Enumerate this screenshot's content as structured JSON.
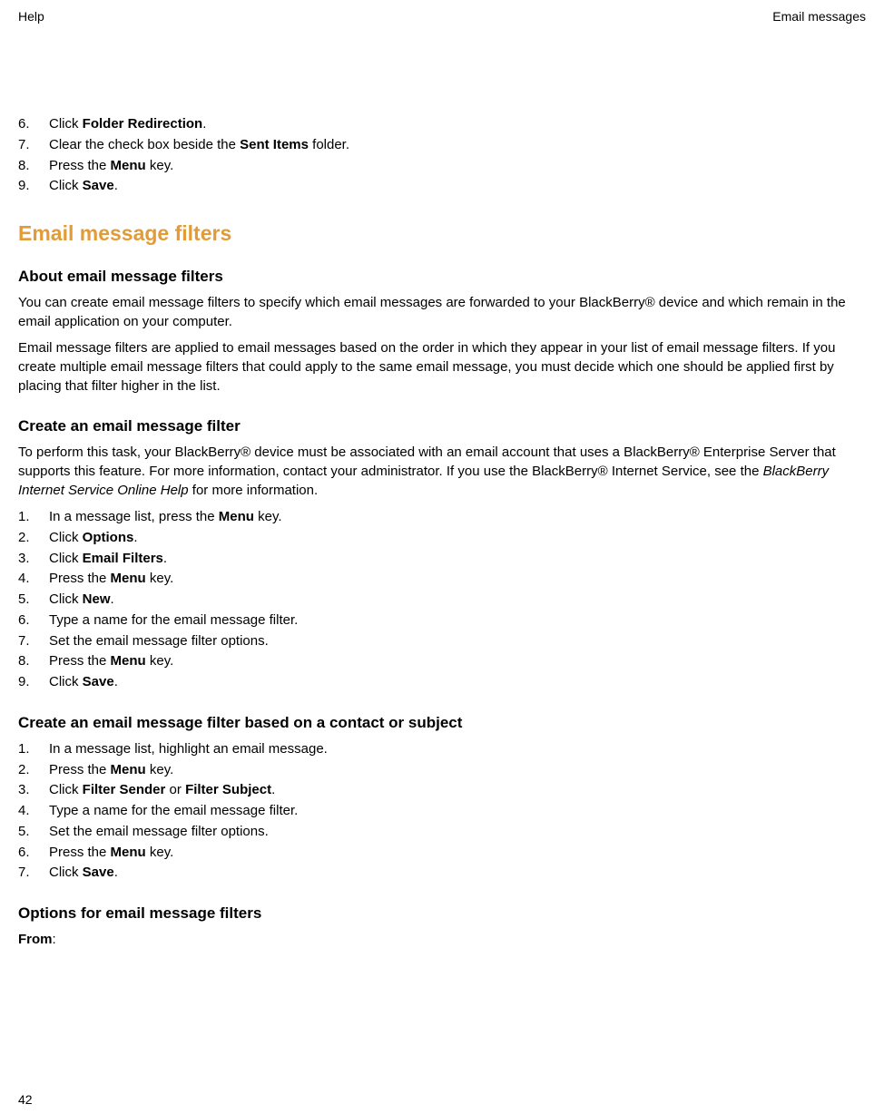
{
  "header": {
    "left": "Help",
    "right": "Email messages"
  },
  "list1": {
    "n6": "6.",
    "n7": "7.",
    "n8": "8.",
    "n9": "9.",
    "i6_pre": "Click ",
    "i6_b": "Folder Redirection",
    "i6_post": ".",
    "i7_pre": "Clear the check box beside the ",
    "i7_b": "Sent Items",
    "i7_post": " folder.",
    "i8_pre": "Press the ",
    "i8_b": "Menu",
    "i8_post": " key.",
    "i9_pre": "Click ",
    "i9_b": "Save",
    "i9_post": "."
  },
  "section1": "Email message filters",
  "sub1": "About email message filters",
  "para1": "You can create email message filters to specify which email messages are forwarded to your BlackBerry® device and which remain in the email application on your computer.",
  "para2": "Email message filters are applied to email messages based on the order in which they appear in your list of email message filters. If you create multiple email message filters that could apply to the same email message, you must decide which one should be applied first by placing that filter higher in the list.",
  "sub2": "Create an email message filter",
  "para3_pre": "To perform this task, your BlackBerry® device must be associated with an email account that uses a BlackBerry® Enterprise Server that supports this feature. For more information, contact your administrator. If you use the BlackBerry® Internet Service, see the ",
  "para3_i": "BlackBerry Internet Service Online Help",
  "para3_post": " for more information.",
  "list2": {
    "n1": "1.",
    "n2": "2.",
    "n3": "3.",
    "n4": "4.",
    "n5": "5.",
    "n6": "6.",
    "n7": "7.",
    "n8": "8.",
    "n9": "9.",
    "i1_pre": "In a message list, press the ",
    "i1_b": "Menu",
    "i1_post": " key.",
    "i2_pre": "Click ",
    "i2_b": "Options",
    "i2_post": ".",
    "i3_pre": "Click ",
    "i3_b": "Email Filters",
    "i3_post": ".",
    "i4_pre": "Press the ",
    "i4_b": "Menu",
    "i4_post": " key.",
    "i5_pre": "Click ",
    "i5_b": "New",
    "i5_post": ".",
    "i6": "Type a name for the email message filter.",
    "i7": "Set the email message filter options.",
    "i8_pre": "Press the ",
    "i8_b": "Menu",
    "i8_post": " key.",
    "i9_pre": "Click ",
    "i9_b": "Save",
    "i9_post": "."
  },
  "sub3": "Create an email message filter based on a contact or subject",
  "list3": {
    "n1": "1.",
    "n2": "2.",
    "n3": "3.",
    "n4": "4.",
    "n5": "5.",
    "n6": "6.",
    "n7": "7.",
    "i1": "In a message list, highlight an email message.",
    "i2_pre": "Press the ",
    "i2_b": "Menu",
    "i2_post": " key.",
    "i3_pre": "Click ",
    "i3_b1": "Filter Sender",
    "i3_mid": " or ",
    "i3_b2": "Filter Subject",
    "i3_post": ".",
    "i4": "Type a name for the email message filter.",
    "i5": "Set the email message filter options.",
    "i6_pre": "Press the ",
    "i6_b": "Menu",
    "i6_post": " key.",
    "i7_pre": "Click ",
    "i7_b": "Save",
    "i7_post": "."
  },
  "sub4": "Options for email message filters",
  "from_label": "From",
  "from_post": ":",
  "pagenum": "42"
}
